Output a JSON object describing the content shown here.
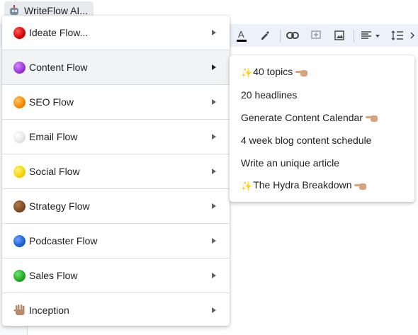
{
  "app_menu": {
    "label": "WriteFlow AI...",
    "icon": "robot-icon"
  },
  "colors": {
    "ideate": "#d60000",
    "content": "#9b30d9",
    "seo": "#f08a00",
    "email": "#e6e6e6",
    "social": "#f5d300",
    "strategy": "#7b4a22",
    "podcaster": "#1a5fd6",
    "sales": "#1ea81e",
    "toolbar_bg": "#edf2fa"
  },
  "menu": {
    "items": [
      {
        "label": "Ideate Flow...",
        "icon": "red-circle-icon"
      },
      {
        "label": "Content Flow",
        "icon": "purple-circle-icon"
      },
      {
        "label": "SEO Flow",
        "icon": "orange-circle-icon"
      },
      {
        "label": "Email Flow",
        "icon": "white-circle-icon"
      },
      {
        "label": "Social Flow",
        "icon": "yellow-circle-icon"
      },
      {
        "label": "Strategy Flow",
        "icon": "brown-circle-icon"
      },
      {
        "label": "Podcaster Flow",
        "icon": "blue-circle-icon"
      },
      {
        "label": "Sales Flow",
        "icon": "green-circle-icon"
      },
      {
        "label": "Inception",
        "icon": "vulcan-salute-icon"
      }
    ]
  },
  "submenu": {
    "items": [
      {
        "label": "40 topics",
        "prefix_icon": "sparkles-icon",
        "suffix_icon": "pointing-left-icon"
      },
      {
        "label": "20 headlines"
      },
      {
        "label": "Generate Content Calendar",
        "suffix_icon": "pointing-left-icon"
      },
      {
        "label": "4 week blog content schedule"
      },
      {
        "label": "Write an unique article"
      },
      {
        "label": "The Hydra Breakdown",
        "prefix_icon": "sparkles-icon",
        "suffix_icon": "pointing-left-icon"
      }
    ]
  },
  "toolbar": {
    "icons": [
      "text-color-icon",
      "highlight-pen-icon",
      "link-icon",
      "add-comment-icon",
      "insert-image-icon",
      "align-left-icon",
      "line-spacing-icon",
      "more-icon"
    ]
  }
}
